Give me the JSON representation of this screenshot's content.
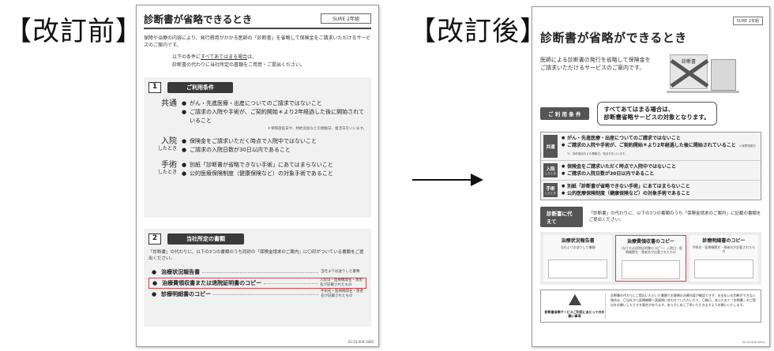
{
  "labels": {
    "before": "【改訂前】",
    "after": "【改訂後】"
  },
  "before_doc": {
    "title": "診断書が省略できるとき",
    "badge": "SURE 2年組",
    "intro": "保障や治療の内容により、発行費用がかかる医師の「診断書」を省略して保険金をご請求いただけるサービスのご案内です。",
    "note_prefix": "以下の条件に",
    "note_underline": "すべてあてはまる場合",
    "note_suffix": "は、",
    "note_line2": "診断書の代わりに当社所定の書類をご用意・ご提出ください。",
    "sec1": {
      "num": "1",
      "label": "ご利用条件",
      "common_label": "共通",
      "common_items": [
        "がん・先進医療・出産についてのご請求ではないこと",
        "ご請求の入院や手術が、ご契約開始＊より2年経過した後に開始されていること"
      ],
      "common_sub": "＊保障旅館日や、特約追加などの異動日、復活日をいいます。",
      "hosp_label": "入院",
      "hosp_sub": "したとき",
      "hosp_items": [
        "保険金をご請求いただく時点で入院中ではないこと",
        "ご請求の入院日数が30日以内であること"
      ],
      "surg_label": "手術",
      "surg_sub": "したとき",
      "surg_items": [
        "別紙「診断書が省略できない手術」にあてはまらないこと",
        "公的医療保険制度（健康保険など）の対象手術であること"
      ]
    },
    "sec2": {
      "num": "2",
      "label": "当社所定の書類",
      "intro": "「診断書」の代わりに、以下の3つの書類のうち同封の「保険金請求のご案内」に〇印がついている書類をご提出ください。",
      "docs": [
        {
          "name": "治療状況報告書",
          "desc": "当社よりお送りした書類"
        },
        {
          "name": "治療費領収書または退院証明書のコピー",
          "desc": "入院日・医療機関名・患者名が記載されたもの"
        },
        {
          "name": "診療明細書のコピー",
          "desc": "手術名・医療機関名・患者名が記載されたもの"
        }
      ]
    },
    "code": "02-03-009-1809"
  },
  "after_doc": {
    "badge": "SURE 2年組",
    "title": "診断書が省略ができるとき",
    "intro": "医師による診断書の発行を省略して保険金をご請求いただけるサービスのご案内です。",
    "illus_text": "診断書",
    "cond_label": "ご 利 用 条 件",
    "callout_line1": "すべてあてはまる場合は、",
    "callout_line2": "診断書省略サービスの対象となります。",
    "common_tag": "共通",
    "common_items": [
      "がん・先進医療・出産についてのご請求ではないこと",
      "ご請求の入院や手術が、ご契約開始＊より2年経過した後に開始されていること"
    ],
    "common_sub": "＊保障旅館日や、特約追加などの異動日、復活日をいいます。",
    "hosp_tag": "入院",
    "hosp_tag_sub": "したとき",
    "hosp_items": [
      "保険金をご請求いただく時点で入院中ではないこと",
      "ご請求の入院日数が30日以内であること"
    ],
    "surg_tag": "手術",
    "surg_tag_sub": "したとき",
    "surg_items": [
      "別紙「診断書が省略できない手術」にあてはまらないこと",
      "公的医療保険制度（健康保険など）の対象手術であること"
    ],
    "replace_label": "診断書に代えて",
    "replace_text": "「診断書」の代わりに、以下の3つの書類のうち「保険金請求のご案内」に記載の書類をご提出ください。",
    "docs": [
      {
        "name": "治療状況報告書",
        "desc": "当社よりお送りした書類"
      },
      {
        "name": "治療費領収書のコピー",
        "desc": "（なければ退院証明書のコピー）入院日・医療機関名・患者名が記載されたもの"
      },
      {
        "name": "診療明細書のコピー",
        "desc": "手術名・医療機関名・患者名が記載されたもの"
      }
    ],
    "footer_title": "診断書省略サービスご利用にあたってのお願い事項",
    "footer_text": "診断書の代わりにご提出いただいた書類でお客様の治療内容が確認できず、お支払いの判断ができない場合は、〇当社から医療機関へ直接問い合わせていただいたり、〇後日、あらためて「診断書」のご提出をお願いしたりする場合があります。あらかじめご了承いただきますようお願いいたします。",
    "code": "02-03-009-2004"
  },
  "colors": {
    "highlight": "#e0403a",
    "dark_label": "#3a3a3a"
  }
}
